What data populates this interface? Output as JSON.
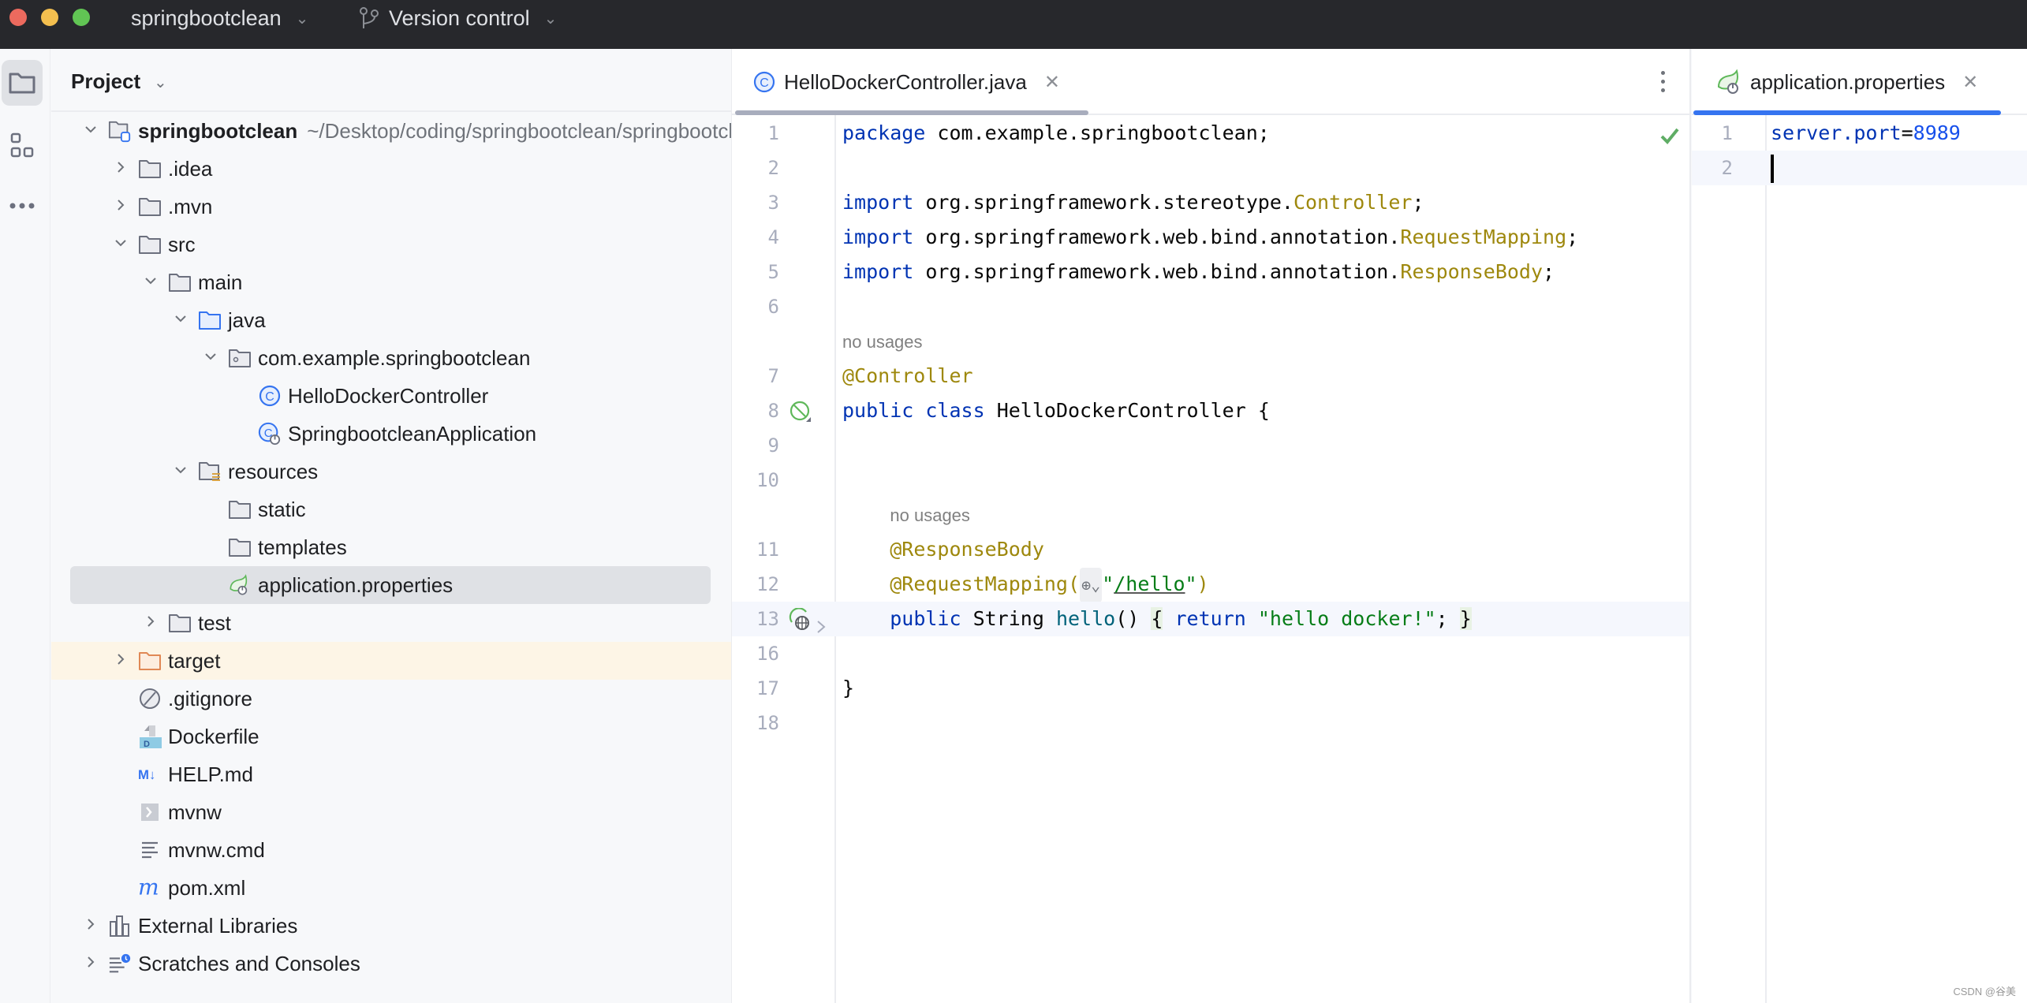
{
  "titlebar": {
    "project_name": "springbootclean",
    "vcs_label": "Version control"
  },
  "toolstrip": {
    "items": [
      {
        "icon": "folder-icon",
        "label": "Project",
        "active": true
      },
      {
        "icon": "structure-icon",
        "label": "Structure",
        "active": false
      },
      {
        "icon": "more-icon",
        "label": "More",
        "active": false
      }
    ]
  },
  "project_panel": {
    "title": "Project",
    "tree": [
      {
        "label": "springbootclean",
        "path": "~/Desktop/coding/springbootclean/springbootclean",
        "icon": "module-folder-icon",
        "level": 0,
        "expanded": true,
        "bold": true
      },
      {
        "label": ".idea",
        "icon": "folder-icon",
        "level": 1,
        "expanded": false
      },
      {
        "label": ".mvn",
        "icon": "folder-icon",
        "level": 1,
        "expanded": false
      },
      {
        "label": "src",
        "icon": "folder-icon",
        "level": 1,
        "expanded": true
      },
      {
        "label": "main",
        "icon": "folder-icon",
        "level": 2,
        "expanded": true
      },
      {
        "label": "java",
        "icon": "source-folder-icon",
        "level": 3,
        "expanded": true
      },
      {
        "label": "com.example.springbootclean",
        "icon": "package-icon",
        "level": 4,
        "expanded": true
      },
      {
        "label": "HelloDockerController",
        "icon": "java-class-icon",
        "level": 5
      },
      {
        "label": "SpringbootcleanApplication",
        "icon": "spring-boot-class-icon",
        "level": 5
      },
      {
        "label": "resources",
        "icon": "resources-folder-icon",
        "level": 3,
        "expanded": true
      },
      {
        "label": "static",
        "icon": "folder-icon",
        "level": 4
      },
      {
        "label": "templates",
        "icon": "folder-icon",
        "level": 4
      },
      {
        "label": "application.properties",
        "icon": "spring-properties-icon",
        "level": 4,
        "selected": true
      },
      {
        "label": "test",
        "icon": "folder-icon",
        "level": 2,
        "expanded": false
      },
      {
        "label": "target",
        "icon": "excluded-folder-icon",
        "level": 1,
        "expanded": false,
        "excluded": true
      },
      {
        "label": ".gitignore",
        "icon": "ignore-file-icon",
        "level": 1
      },
      {
        "label": "Dockerfile",
        "icon": "docker-file-icon",
        "level": 1
      },
      {
        "label": "HELP.md",
        "icon": "markdown-icon",
        "level": 1
      },
      {
        "label": "mvnw",
        "icon": "shell-script-icon",
        "level": 1
      },
      {
        "label": "mvnw.cmd",
        "icon": "text-file-icon",
        "level": 1
      },
      {
        "label": "pom.xml",
        "icon": "maven-icon",
        "level": 1
      },
      {
        "label": "External Libraries",
        "icon": "libraries-icon",
        "level": 0,
        "expanded": false
      },
      {
        "label": "Scratches and Consoles",
        "icon": "scratches-icon",
        "level": 0,
        "expanded": false
      }
    ]
  },
  "editor_main": {
    "tab": {
      "label": "HelloDockerController.java",
      "icon": "java-class-icon"
    },
    "inspection_status": "no-problems",
    "hint_no_usages": "no usages",
    "lines": [
      {
        "num": "1",
        "tokens": [
          [
            "kw",
            "package"
          ],
          [
            "",
            " com.example.springbootclean;"
          ]
        ]
      },
      {
        "num": "2",
        "tokens": []
      },
      {
        "num": "3",
        "tokens": [
          [
            "kw",
            "import"
          ],
          [
            "",
            " org.springframework.stereotype."
          ],
          [
            "ann",
            "Controller"
          ],
          [
            "",
            ";"
          ]
        ]
      },
      {
        "num": "4",
        "tokens": [
          [
            "kw",
            "import"
          ],
          [
            "",
            " org.springframework.web.bind.annotation."
          ],
          [
            "ann",
            "RequestMapping"
          ],
          [
            "",
            ";"
          ]
        ]
      },
      {
        "num": "5",
        "tokens": [
          [
            "kw",
            "import"
          ],
          [
            "",
            " org.springframework.web.bind.annotation."
          ],
          [
            "ann",
            "ResponseBody"
          ],
          [
            "",
            ";"
          ]
        ]
      },
      {
        "num": "6",
        "tokens": []
      },
      {
        "hint": "no usages",
        "indent": 0
      },
      {
        "num": "7",
        "tokens": [
          [
            "ann",
            "@Controller"
          ]
        ]
      },
      {
        "num": "8",
        "tokens": [
          [
            "kw",
            "public"
          ],
          [
            "",
            " "
          ],
          [
            "kw",
            "class"
          ],
          [
            "",
            " HelloDockerController {"
          ]
        ],
        "gutter_icon": "spring-bean-icon"
      },
      {
        "num": "9",
        "tokens": []
      },
      {
        "num": "10",
        "tokens": []
      },
      {
        "hint": "no usages",
        "indent": 4
      },
      {
        "num": "11",
        "tokens": [
          [
            "",
            "    "
          ],
          [
            "ann",
            "@ResponseBody"
          ]
        ]
      },
      {
        "num": "12",
        "tokens": [
          [
            "",
            "    "
          ],
          [
            "ann",
            "@RequestMapping"
          ],
          [
            "ann",
            "("
          ],
          [
            "inlay",
            "⊕⌄"
          ],
          [
            "str",
            "\""
          ],
          [
            "url",
            "/hello"
          ],
          [
            "str",
            "\""
          ],
          [
            "ann",
            ")"
          ]
        ]
      },
      {
        "num": "13",
        "tokens": [
          [
            "",
            "    "
          ],
          [
            "kw",
            "public"
          ],
          [
            "",
            " String "
          ],
          [
            "fn",
            "hello"
          ],
          [
            "",
            "() "
          ],
          [
            "brace",
            "{"
          ],
          [
            "",
            " "
          ],
          [
            "kw",
            "return"
          ],
          [
            "",
            " "
          ],
          [
            "str",
            "\"hello docker!\""
          ],
          [
            "",
            ";"
          ],
          [
            "",
            " "
          ],
          [
            "brace",
            "}"
          ]
        ],
        "gutter_icon": "web-endpoint-icon",
        "current": true,
        "folded": true
      },
      {
        "num": "16",
        "tokens": []
      },
      {
        "num": "17",
        "tokens": [
          [
            "",
            "}"
          ]
        ]
      },
      {
        "num": "18",
        "tokens": []
      }
    ]
  },
  "editor_right": {
    "tab": {
      "label": "application.properties",
      "icon": "spring-properties-icon"
    },
    "lines": [
      {
        "num": "1",
        "key": "server.port",
        "eq": "=",
        "value": "8989"
      },
      {
        "num": "2",
        "key": "",
        "eq": "",
        "value": "",
        "caret": true
      }
    ]
  },
  "colors": {
    "titlebar_bg": "#27282c",
    "accent": "#3574f0",
    "keyword": "#0033b3",
    "annotation": "#9e880d",
    "string": "#067d17",
    "selected_row": "#dfe1e5",
    "excluded_row": "#fdf5e6"
  },
  "watermark": "CSDN @谷美"
}
